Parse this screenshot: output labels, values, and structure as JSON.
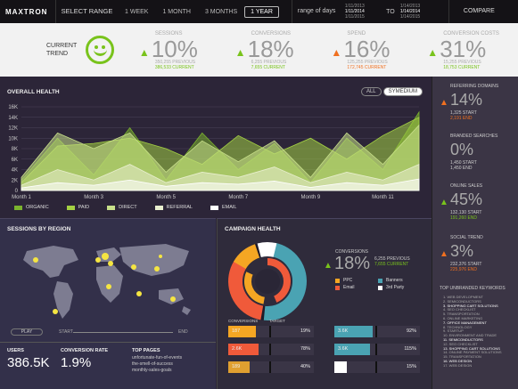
{
  "topbar": {
    "logo": "MAXTRON",
    "select_range": "SELECT RANGE",
    "ranges": [
      "1 WEEK",
      "1 MONTH",
      "3 MONTHS",
      "1 YEAR"
    ],
    "active_range": "1 YEAR",
    "range_of_days": "range of days",
    "from_dates": [
      "1/11/2013",
      "1/11/2014",
      "1/11/2015"
    ],
    "to_label": "TO",
    "to_dates": [
      "1/14/2013",
      "1/14/2014",
      "1/14/2015"
    ],
    "compare": "COMPARE"
  },
  "trend": {
    "label_line1": "CURRENT",
    "label_line2": "TREND",
    "metrics": [
      {
        "label": "SESSIONS",
        "value": "10%",
        "direction": "up",
        "prev": "350,255 PREVIOUS",
        "current": "386,533 CURRENT",
        "color": "#79c31c"
      },
      {
        "label": "CONVERSIONS",
        "value": "18%",
        "direction": "up",
        "prev": "6,255 PREVIOUS",
        "current": "7,655 CURRENT",
        "color": "#79c31c"
      },
      {
        "label": "SPEND",
        "value": "16%",
        "direction": "up",
        "prev": "125,255 PREVIOUS",
        "current": "172,745 CURRENT",
        "color": "#f07020"
      },
      {
        "label": "CONVERSION COSTS",
        "value": "31%",
        "direction": "up",
        "prev": "15,255 PREVIOUS",
        "current": "18,753 CURRENT",
        "color": "#79c31c"
      }
    ]
  },
  "overall": {
    "title": "OVERALL HEALTH",
    "toggle": [
      "ALL",
      "SYMEDIUM"
    ],
    "toggle_active": "SYMEDIUM",
    "legend": [
      {
        "name": "ORGANIC",
        "color": "#7bb32e"
      },
      {
        "name": "PAID",
        "color": "#a4d143"
      },
      {
        "name": "DIRECT",
        "color": "#c8e08a"
      },
      {
        "name": "REFERRAL",
        "color": "#e9efcf"
      },
      {
        "name": "EMAIL",
        "color": "#ffffff"
      }
    ]
  },
  "chart_data": {
    "type": "area",
    "x": [
      "Month 1",
      "Month 2",
      "Month 3",
      "Month 4",
      "Month 5",
      "Month 6",
      "Month 7",
      "Month 8",
      "Month 9",
      "Month 10",
      "Month 11",
      "Month 12"
    ],
    "xticks": [
      "Month 1",
      "Month 3",
      "Month 5",
      "Month 7",
      "Month 9",
      "Month 11"
    ],
    "yticks": [
      "0",
      "2K",
      "4K",
      "6K",
      "8K",
      "10K",
      "12K",
      "14K",
      "16K"
    ],
    "ylim": [
      0,
      16000
    ],
    "series": [
      {
        "name": "ORGANIC",
        "color": "#7bb32e",
        "values": [
          2000,
          10000,
          3000,
          12000,
          2000,
          11000,
          4000,
          9000,
          1500,
          10000,
          4000,
          15000
        ]
      },
      {
        "name": "PAID",
        "color": "#a4d143",
        "values": [
          1500,
          8500,
          9000,
          10000,
          8000,
          5000,
          10500,
          7000,
          10000,
          6000,
          10500,
          14000
        ]
      },
      {
        "name": "DIRECT",
        "color": "#c8e08a",
        "values": [
          2500,
          11000,
          8000,
          11000,
          3500,
          9500,
          5500,
          9500,
          2500,
          11000,
          5000,
          12500
        ]
      },
      {
        "name": "REFERRAL",
        "color": "#e9efcf",
        "values": [
          1000,
          4000,
          2000,
          5000,
          1500,
          3500,
          2500,
          4500,
          1500,
          3500,
          2000,
          5000
        ]
      },
      {
        "name": "EMAIL",
        "color": "#ffffff",
        "values": [
          500,
          1500,
          1000,
          2000,
          800,
          1500,
          1200,
          1800,
          600,
          1500,
          1000,
          2200
        ]
      }
    ]
  },
  "right": {
    "items": [
      {
        "label": "REFERRING DOMAINS",
        "value": "14%",
        "arrow": "▲",
        "color": "#f07020",
        "l1": "1,325 START",
        "l2": "2,191 END"
      },
      {
        "label": "BRANDED SEARCHES",
        "value": "0%",
        "arrow": "",
        "color": "#cccccc",
        "l1": "1,450 START",
        "l2": "1,450 END"
      },
      {
        "label": "ONLINE SALES",
        "value": "45%",
        "arrow": "▲",
        "color": "#79c31c",
        "l1": "132,130 START",
        "l2": "191,260 END"
      },
      {
        "label": "SOCIAL TREND",
        "value": "3%",
        "arrow": "▲",
        "color": "#f07020",
        "l1": "232,376 START",
        "l2": "225,976 END"
      }
    ],
    "kw_title": "TOP UNBRANDED KEYWORDS",
    "keywords": [
      "WEB DEVELOPMENT",
      "SEMICONDUCTORS",
      "SHOPPING CART SOLUTIONS",
      "SEO CHECKLIST",
      "TRANSPORTATION",
      "ONLINE MARKETING",
      "OFFICE MANAGEMENT",
      "TECHNOLOGY",
      "STARTUP",
      "ENVIRONMENT AND TRADE",
      "SEMICONDUCTORS",
      "SEO CHECKLIST",
      "SHOPPING CART SOLUTIONS",
      "ONLINE PAYMENT SOLUTIONS",
      "TRANSPORTATION",
      "WEB DESIGN",
      "WEB DESIGN"
    ]
  },
  "sessions": {
    "title": "SESSIONS BY REGION",
    "play": "PLAY",
    "start": "START",
    "end": "END",
    "users_label": "USERS",
    "users_value": "386.5K",
    "conv_rate_label": "CONVERSION RATE",
    "conv_rate_value": "1.9%",
    "top_pages_label": "TOP PAGES",
    "top_pages": [
      "unfortunate-fun-of-events",
      "the-smell-of-success",
      "monthly-sales-goals"
    ]
  },
  "campaign": {
    "title": "CAMPAIGN HEALTH",
    "conv_label": "CONVERSIONS",
    "conv_value": "18%",
    "conv_prev": "6,255 PREVIOUS",
    "conv_current": "7,655 CURRENT",
    "legend": [
      {
        "name": "PPC",
        "color": "#f5a623"
      },
      {
        "name": "Email",
        "color": "#f05a3a"
      },
      {
        "name": "Banners",
        "color": "#4aa3b3"
      },
      {
        "name": "3rd Party",
        "color": "#ffffff"
      }
    ],
    "bar_headers": [
      "CONVERSIONS",
      "TARGET"
    ],
    "bars": [
      {
        "v1": "187",
        "v2": "19%",
        "pct": 0.32,
        "color": "#f5a623"
      },
      {
        "v1": "2.6K",
        "v2": "78%",
        "pct": 0.35,
        "color": "#f05a3a"
      },
      {
        "v1": "189",
        "v2": "40%",
        "pct": 0.25,
        "color": "#e0a030"
      },
      {
        "v1": "3.6K",
        "v2": "92%",
        "pct": 0.45,
        "color": "#4aa3b3"
      },
      {
        "v1": "3.6K",
        "v2": "115%",
        "pct": 0.42,
        "color": "#4aa3b3"
      },
      {
        "v1": "",
        "v2": "15%",
        "pct": 0.15,
        "color": "#ffffff"
      }
    ]
  }
}
